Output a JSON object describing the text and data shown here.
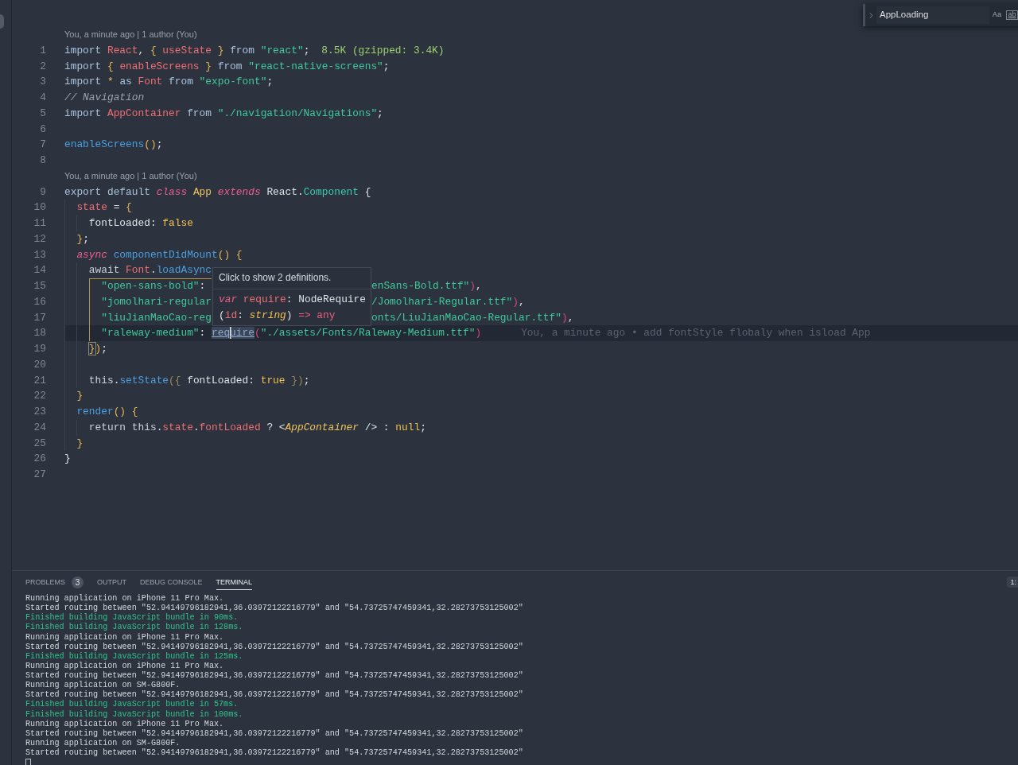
{
  "editor": {
    "find_widget": {
      "value": "AppLoading",
      "match_case": "Aa",
      "whole_word": "ab"
    },
    "blocks": [
      {
        "codelens": "You, a minute ago | 1 author (You)",
        "lines": [
          {
            "number": "1",
            "current": false,
            "guide": false,
            "code": [
              {
                "text": "import ",
                "kind": "kw"
              },
              {
                "text": "React",
                "kind": "ident"
              },
              {
                "text": ", ",
                "kind": "plain"
              },
              {
                "text": "{ ",
                "kind": "punct"
              },
              {
                "text": "useState ",
                "kind": "ident"
              },
              {
                "text": "} ",
                "kind": "punct"
              },
              {
                "text": "from ",
                "kind": "kw"
              },
              {
                "text": "\"react\"",
                "kind": "str"
              },
              {
                "text": ";",
                "kind": "plain"
              }
            ],
            "annotation": {
              "kind": "size",
              "text": "8.5K (gzipped: 3.4K)"
            }
          },
          {
            "number": "2",
            "current": false,
            "guide": false,
            "code": [
              {
                "text": "import ",
                "kind": "kw"
              },
              {
                "text": "{ ",
                "kind": "punct"
              },
              {
                "text": "enableScreens ",
                "kind": "ident"
              },
              {
                "text": "} ",
                "kind": "punct"
              },
              {
                "text": "from ",
                "kind": "kw"
              },
              {
                "text": "\"react-native-screens\"",
                "kind": "str"
              },
              {
                "text": ";",
                "kind": "plain"
              }
            ]
          },
          {
            "number": "3",
            "current": false,
            "guide": false,
            "code": [
              {
                "text": "import ",
                "kind": "kw"
              },
              {
                "text": "* ",
                "kind": "lit"
              },
              {
                "text": "as ",
                "kind": "kw"
              },
              {
                "text": "Font ",
                "kind": "ident"
              },
              {
                "text": "from ",
                "kind": "kw"
              },
              {
                "text": "\"expo-font\"",
                "kind": "str"
              },
              {
                "text": ";",
                "kind": "plain"
              }
            ]
          },
          {
            "number": "4",
            "current": false,
            "guide": false,
            "code": [
              {
                "text": "// Navigation",
                "kind": "comment"
              }
            ]
          },
          {
            "number": "5",
            "current": false,
            "guide": false,
            "code": [
              {
                "text": "import ",
                "kind": "kw"
              },
              {
                "text": "AppContainer ",
                "kind": "ident"
              },
              {
                "text": "from ",
                "kind": "kw"
              },
              {
                "text": "\"./navigation/Navigations\"",
                "kind": "str"
              },
              {
                "text": ";",
                "kind": "plain"
              }
            ]
          },
          {
            "number": "6",
            "current": false,
            "guide": false
          },
          {
            "number": "7",
            "current": false,
            "guide": false,
            "code": [
              {
                "text": "enableScreens",
                "kind": "fn"
              },
              {
                "text": "()",
                "kind": "punct"
              },
              {
                "text": ";",
                "kind": "plain"
              }
            ]
          },
          {
            "number": "8",
            "current": false,
            "guide": false
          }
        ]
      },
      {
        "codelens": "You, a minute ago | 1 author (You)",
        "lines": [
          {
            "number": "9",
            "current": false,
            "guide": false,
            "code": [
              {
                "text": "export default ",
                "kind": "kw"
              },
              {
                "text": "class ",
                "kind": "mod"
              },
              {
                "text": "App ",
                "kind": "cls"
              },
              {
                "text": "extends ",
                "kind": "mod"
              },
              {
                "text": "React.",
                "kind": "plain"
              },
              {
                "text": "Component ",
                "kind": "type"
              },
              {
                "text": "{",
                "kind": "plain"
              }
            ],
            "children": [
              {
                "number": "10",
                "current": false,
                "guide": false,
                "code": [
                  {
                    "text": "state ",
                    "kind": "ident"
                  },
                  {
                    "text": "= ",
                    "kind": "plain"
                  },
                  {
                    "text": "{",
                    "kind": "punct"
                  }
                ],
                "children": [
                  {
                    "number": "11",
                    "current": false,
                    "guide": false,
                    "code": [
                      {
                        "text": "fontLoaded: ",
                        "kind": "plain"
                      },
                      {
                        "text": "false",
                        "kind": "lit"
                      }
                    ]
                  }
                ]
              },
              {
                "number": "12",
                "current": false,
                "guide": false,
                "code": [
                  {
                    "text": "}",
                    "kind": "punct"
                  },
                  {
                    "text": ";",
                    "kind": "plain"
                  }
                ]
              },
              {
                "number": "13",
                "current": false,
                "guide": false,
                "code": [
                  {
                    "text": "async ",
                    "kind": "mod"
                  },
                  {
                    "text": "componentDidMount",
                    "kind": "fn"
                  },
                  {
                    "text": "() ",
                    "kind": "punct"
                  },
                  {
                    "text": "{",
                    "kind": "punct"
                  }
                ],
                "children": [
                  {
                    "number": "14",
                    "current": false,
                    "guide": false,
                    "code": [
                      {
                        "text": "await ",
                        "kind": "kw2"
                      },
                      {
                        "text": "Font",
                        "kind": "ident"
                      },
                      {
                        "text": ".",
                        "kind": "plain"
                      },
                      {
                        "text": "loadAsync",
                        "kind": "fn"
                      }
                    ],
                    "children": [
                      {
                        "number": "15",
                        "current": false,
                        "guide": true,
                        "code": [
                          {
                            "text": "\"open-sans-bold\"",
                            "kind": "str"
                          },
                          {
                            "text": ":",
                            "kind": "plain"
                          }
                        ],
                        "after_popup": [
                          {
                            "text": "enSans-Bold.ttf\"",
                            "kind": "str"
                          },
                          {
                            "text": ")",
                            "kind": "paren"
                          },
                          {
                            "text": ",",
                            "kind": "plain"
                          }
                        ]
                      },
                      {
                        "number": "16",
                        "current": false,
                        "guide": true,
                        "code": [
                          {
                            "text": "\"jomolhari-regular",
                            "kind": "str"
                          }
                        ],
                        "after_popup": [
                          {
                            "text": "/Jomolhari-Regular.ttf\"",
                            "kind": "str"
                          },
                          {
                            "text": ")",
                            "kind": "paren"
                          },
                          {
                            "text": ",",
                            "kind": "plain"
                          }
                        ]
                      },
                      {
                        "number": "17",
                        "current": false,
                        "guide": true,
                        "code": [
                          {
                            "text": "\"liuJianMaoCao-reg",
                            "kind": "str"
                          }
                        ],
                        "after_popup": [
                          {
                            "text": "onts/LiuJianMaoCao-Regular.ttf\"",
                            "kind": "str"
                          },
                          {
                            "text": ")",
                            "kind": "paren"
                          },
                          {
                            "text": ",",
                            "kind": "plain"
                          }
                        ]
                      },
                      {
                        "number": "18",
                        "current": true,
                        "guide": true,
                        "code": [
                          {
                            "text": "\"raleway-medium\"",
                            "kind": "str"
                          },
                          {
                            "text": ": ",
                            "kind": "plain"
                          },
                          {
                            "text": "req",
                            "kind": "link"
                          },
                          {
                            "text": "uire",
                            "kind": "link_cursor"
                          },
                          {
                            "text": "(",
                            "kind": "paren"
                          },
                          {
                            "text": "\"./assets/Fonts/Raleway-Medium.ttf\"",
                            "kind": "str"
                          },
                          {
                            "text": ")",
                            "kind": "paren"
                          }
                        ],
                        "annotation": {
                          "kind": "blame",
                          "text": "You, a minute ago • add fontStyle flobaly when isload App"
                        }
                      }
                    ]
                  },
                  {
                    "number": "19",
                    "current": false,
                    "guide": false,
                    "code": [
                      {
                        "text": "}",
                        "kind": "brace"
                      },
                      {
                        "text": ")",
                        "kind": "punct"
                      },
                      {
                        "text": ";",
                        "kind": "plain"
                      }
                    ]
                  },
                  {
                    "number": "20",
                    "current": false,
                    "guide": false
                  },
                  {
                    "number": "21",
                    "current": false,
                    "guide": false,
                    "code": [
                      {
                        "text": "this",
                        "kind": "kw2"
                      },
                      {
                        "text": ".",
                        "kind": "plain"
                      },
                      {
                        "text": "setState",
                        "kind": "fn"
                      },
                      {
                        "text": "({ ",
                        "kind": "dimpunct"
                      },
                      {
                        "text": "fontLoaded: ",
                        "kind": "plain"
                      },
                      {
                        "text": "true ",
                        "kind": "lit"
                      },
                      {
                        "text": "})",
                        "kind": "dimpunct"
                      },
                      {
                        "text": ";",
                        "kind": "plain"
                      }
                    ]
                  }
                ]
              },
              {
                "number": "22",
                "current": false,
                "guide": false,
                "code": [
                  {
                    "text": "}",
                    "kind": "punct"
                  }
                ]
              },
              {
                "number": "23",
                "current": false,
                "guide": false,
                "code": [
                  {
                    "text": "render",
                    "kind": "fn"
                  },
                  {
                    "text": "() ",
                    "kind": "punct"
                  },
                  {
                    "text": "{",
                    "kind": "punct"
                  }
                ],
                "children": [
                  {
                    "number": "24",
                    "current": false,
                    "guide": false,
                    "code": [
                      {
                        "text": "return this",
                        "kind": "kw2"
                      },
                      {
                        "text": ".",
                        "kind": "plain"
                      },
                      {
                        "text": "state",
                        "kind": "ident"
                      },
                      {
                        "text": ".",
                        "kind": "plain"
                      },
                      {
                        "text": "fontLoaded ",
                        "kind": "ident"
                      },
                      {
                        "text": "? <",
                        "kind": "plain"
                      },
                      {
                        "text": "AppContainer ",
                        "kind": "jsx"
                      },
                      {
                        "text": "/> : ",
                        "kind": "plain"
                      },
                      {
                        "text": "null",
                        "kind": "lit"
                      },
                      {
                        "text": ";",
                        "kind": "plain"
                      }
                    ]
                  }
                ]
              },
              {
                "number": "25",
                "current": false,
                "guide": false,
                "code": [
                  {
                    "text": "}",
                    "kind": "punct"
                  }
                ]
              }
            ]
          },
          {
            "number": "26",
            "current": false,
            "guide": false,
            "code": [
              {
                "text": "}",
                "kind": "plain"
              }
            ]
          },
          {
            "number": "27",
            "current": false,
            "guide": false
          }
        ]
      }
    ],
    "hover": {
      "hint": "Click to show 2 definitions.",
      "signature": [
        [
          {
            "text": "var ",
            "kind": "mod"
          },
          {
            "text": "require",
            "kind": "ident"
          },
          {
            "text": ": ",
            "kind": "plain"
          },
          {
            "text": "NodeRequire",
            "kind": "plain"
          }
        ],
        [
          {
            "text": "(",
            "kind": "plain"
          },
          {
            "text": "id",
            "kind": "ident"
          },
          {
            "text": ": ",
            "kind": "plain"
          },
          {
            "text": "string",
            "kind": "typeit"
          },
          {
            "text": ") ",
            "kind": "plain"
          },
          {
            "text": "=> ",
            "kind": "op"
          },
          {
            "text": "any",
            "kind": "op"
          }
        ]
      ]
    }
  },
  "panel": {
    "tabs": [
      {
        "label": "PROBLEMS",
        "selected": false,
        "badge": "3"
      },
      {
        "label": "OUTPUT",
        "selected": false
      },
      {
        "label": "DEBUG CONSOLE",
        "selected": false
      },
      {
        "label": "TERMINAL",
        "selected": true
      }
    ],
    "terminal_selector": "1:",
    "terminal": [
      {
        "kind": "output",
        "text": "Running application on iPhone 11 Pro Max."
      },
      {
        "kind": "output",
        "text": "Started routing between \"52.94149796182941,36.03972122216779\" and \"54.73725747459341,32.28273753125002\""
      },
      {
        "kind": "success",
        "text": "Finished building JavaScript bundle in 90ms."
      },
      {
        "kind": "success",
        "text": "Finished building JavaScript bundle in 128ms."
      },
      {
        "kind": "output",
        "text": "Running application on iPhone 11 Pro Max."
      },
      {
        "kind": "output",
        "text": "Started routing between \"52.94149796182941,36.03972122216779\" and \"54.73725747459341,32.28273753125002\""
      },
      {
        "kind": "success",
        "text": "Finished building JavaScript bundle in 125ms."
      },
      {
        "kind": "output",
        "text": "Running application on iPhone 11 Pro Max."
      },
      {
        "kind": "output",
        "text": "Started routing between \"52.94149796182941,36.03972122216779\" and \"54.73725747459341,32.28273753125002\""
      },
      {
        "kind": "output",
        "text": "Running application on SM-G800F."
      },
      {
        "kind": "output",
        "text": "Started routing between \"52.94149796182941,36.03972122216779\" and \"54.73725747459341,32.28273753125002\""
      },
      {
        "kind": "success",
        "text": "Finished building JavaScript bundle in 57ms."
      },
      {
        "kind": "success",
        "text": "Finished building JavaScript bundle in 100ms."
      },
      {
        "kind": "output",
        "text": "Running application on iPhone 11 Pro Max."
      },
      {
        "kind": "output",
        "text": "Started routing between \"52.94149796182941,36.03972122216779\" and \"54.73725747459341,32.28273753125002\""
      },
      {
        "kind": "output",
        "text": "Running application on SM-G800F."
      },
      {
        "kind": "output",
        "text": "Started routing between \"52.94149796182941,36.03972122216779\" and \"54.73725747459341,32.28273753125002\""
      }
    ]
  }
}
